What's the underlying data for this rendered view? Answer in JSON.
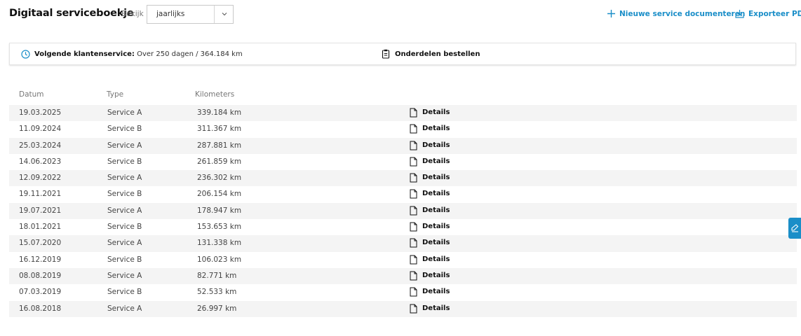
{
  "header": {
    "title": "Digitaal serviceboekje",
    "view_label": "Bekijk",
    "view_select": {
      "value": "jaarlijks",
      "icon": "chevron-down-icon"
    },
    "actions": {
      "new_service": {
        "label": "Nieuwe service documenteren",
        "icon": "plus-icon"
      },
      "export_pdf": {
        "label": "Exporteer PDF",
        "icon": "download-icon"
      }
    }
  },
  "info_bar": {
    "next_service_label": "Volgende klantenservice:",
    "next_service_value": "Over 250 dagen / 364.184 km",
    "order_parts_label": "Onderdelen bestellen"
  },
  "table": {
    "columns": [
      "Datum",
      "Type",
      "Kilometers"
    ],
    "details_label": "Details",
    "rows": [
      {
        "date": "19.03.2025",
        "type": "Service A",
        "km": "339.184 km"
      },
      {
        "date": "11.09.2024",
        "type": "Service B",
        "km": "311.367 km"
      },
      {
        "date": "25.03.2024",
        "type": "Service A",
        "km": "287.881 km"
      },
      {
        "date": "14.06.2023",
        "type": "Service B",
        "km": "261.859 km"
      },
      {
        "date": "12.09.2022",
        "type": "Service A",
        "km": "236.302 km"
      },
      {
        "date": "19.11.2021",
        "type": "Service B",
        "km": "206.154 km"
      },
      {
        "date": "19.07.2021",
        "type": "Service A",
        "km": "178.947 km"
      },
      {
        "date": "18.01.2021",
        "type": "Service B",
        "km": "153.653 km"
      },
      {
        "date": "15.07.2020",
        "type": "Service A",
        "km": "131.338 km"
      },
      {
        "date": "16.12.2019",
        "type": "Service B",
        "km": "106.023 km"
      },
      {
        "date": "08.08.2019",
        "type": "Service A",
        "km": "82.771 km"
      },
      {
        "date": "07.03.2019",
        "type": "Service B",
        "km": "52.533 km"
      },
      {
        "date": "16.08.2018",
        "type": "Service A",
        "km": "26.997 km"
      }
    ]
  },
  "colors": {
    "accent": "#1a8ec8",
    "row_shade": "#f4f4f4",
    "muted_text": "#777777"
  }
}
